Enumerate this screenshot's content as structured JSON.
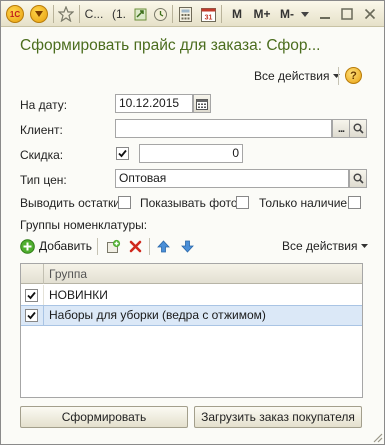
{
  "toolbar": {
    "window_short_title": "С...",
    "counter": "(1.",
    "m_label": "M",
    "m_plus_label": "M+",
    "m_minus_label": "M-"
  },
  "form": {
    "title": "Сформировать прайс для заказа: Сфор...",
    "all_actions": "Все действия",
    "help": "?"
  },
  "fields": {
    "date_label": "На дату:",
    "date_value": "10.12.2015",
    "client_label": "Клиент:",
    "client_value": "",
    "client_select": "...",
    "discount_label": "Скидка:",
    "discount_value": "0",
    "price_type_label": "Тип цен:",
    "price_type_value": "Оптовая",
    "show_stock_label": "Выводить остатки:",
    "show_photo_label": "Показывать фото:",
    "only_available_label": "Только наличие:"
  },
  "groups": {
    "section_label": "Группы номенклатуры:",
    "add_label": "Добавить",
    "all_actions": "Все действия",
    "column_header": "Группа",
    "rows": [
      {
        "name": "НОВИНКИ",
        "checked": true
      },
      {
        "name": "Наборы для уборки (ведра с отжимом)",
        "checked": true
      }
    ]
  },
  "buttons": {
    "generate": "Сформировать",
    "load_order": "Загрузить заказ покупателя"
  },
  "colors": {
    "title": "#4b6d1e",
    "selected_row": "#dbe8f7",
    "accent_orange": "#e48a1c"
  }
}
